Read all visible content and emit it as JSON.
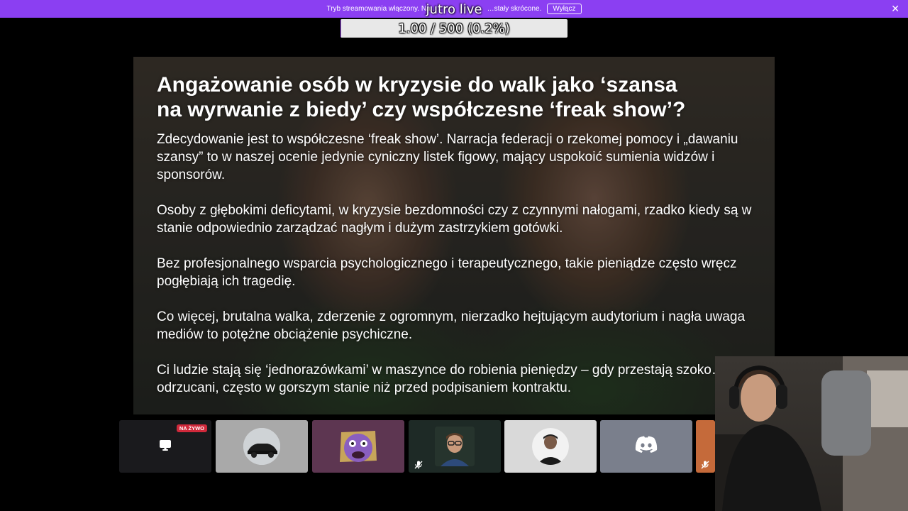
{
  "banner": {
    "text": "Tryb streamowania włączony. Na…",
    "text_tail": "…stały skrócone.",
    "button_label": "Wyłącz",
    "close_icon": "close-icon"
  },
  "overlay": {
    "title": "jutro live",
    "progress_text": "1.00 / 500 (0.2%)",
    "progress_fraction": 0.002
  },
  "slide": {
    "title_line1": "Angażowanie osób w kryzysie do walk jako ‘szansa",
    "title_line2": "na wyrwanie z biedy’ czy współczesne ‘freak show’?",
    "paragraphs": [
      "Zdecydowanie jest to współczesne ‘freak show’. Narracja federacji o rzekomej pomocy i „dawaniu szansy” to w naszej ocenie jedynie cyniczny listek figowy, mający uspokoić sumienia widzów i sponsorów.",
      "Osoby z głębokimi deficytami, w kryzysie bezdomności czy z czynnymi nałogami, rzadko kiedy są w stanie odpowiednio zarządzać nagłym i dużym zastrzykiem gotówki.",
      "Bez profesjonalnego wsparcia psychologicznego i terapeutycznego, takie pieniądze często wręcz pogłębiają ich tragedię.",
      "Co więcej, brutalna walka, zderzenie z ogromnym, nierzadko hejtującym audytorium i nagła uwaga mediów to potężne obciążenie psychiczne.",
      "Ci ludzie stają się ‘jednorazówkami’ w maszynce do robienia pieniędzy – gdy przestają szoko… są odrzucani, często w gorszym stanie niż przed podpisaniem kontraktu."
    ]
  },
  "tiles": {
    "live_badge": "NA ŻYWO",
    "colors": {
      "screen": "#1a1a1d",
      "car": "#a9a9a9",
      "sticker": "#5d3651",
      "cam": "#1e2a26",
      "person": "#d9d9d9",
      "discord": "#7a7f8c",
      "partial": "#c56a3a"
    }
  },
  "colors": {
    "banner": "#8b3ff2",
    "live_badge": "#d0293b"
  }
}
